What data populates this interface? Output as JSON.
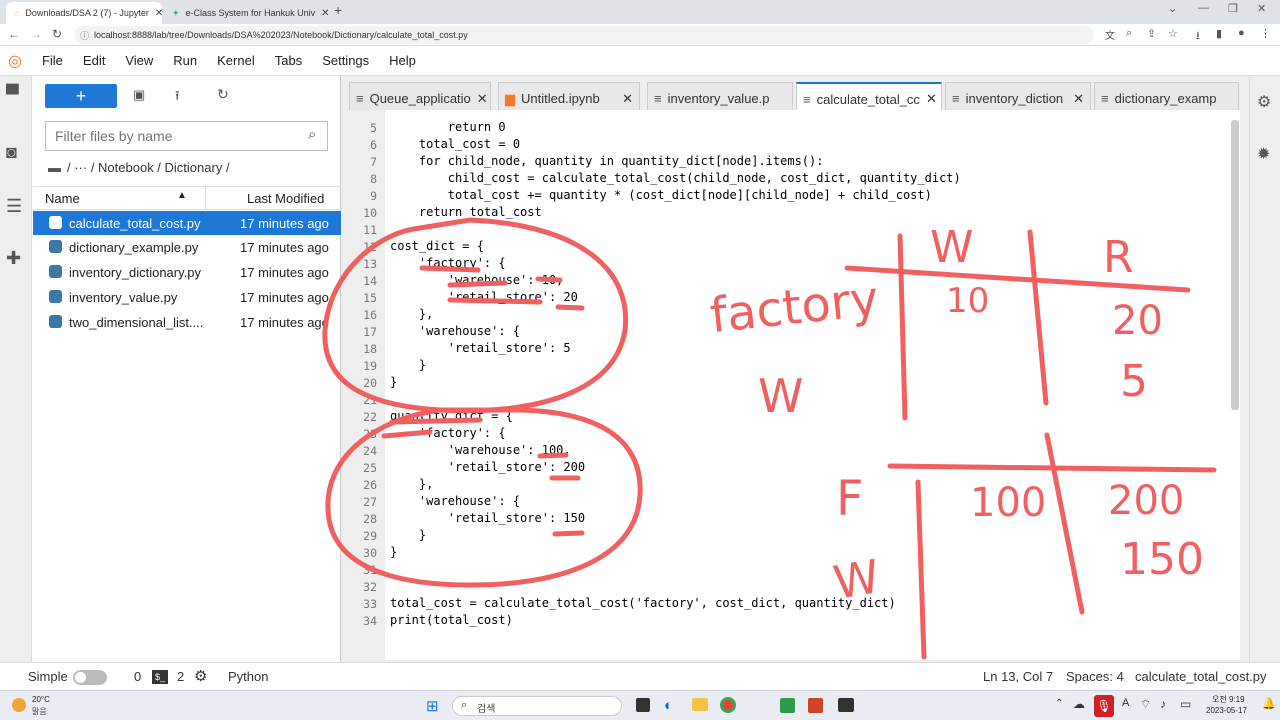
{
  "browser": {
    "tabs": [
      {
        "label": "Downloads/DSA 2 (7) - Jupyter",
        "close": "✕"
      },
      {
        "label": "e-Class System for Hankuk Univ",
        "close": "✕"
      }
    ],
    "new_tab": "+",
    "url": "localhost:8888/lab/tree/Downloads/DSA%202023/Notebook/Dictionary/calculate_total_cost.py"
  },
  "menu": [
    "File",
    "Edit",
    "View",
    "Run",
    "Kernel",
    "Tabs",
    "Settings",
    "Help"
  ],
  "filebrowser": {
    "new_button": "+",
    "filter_placeholder": "Filter files by name",
    "breadcrumb": "/ ··· / Notebook / Dictionary /",
    "col_name": "Name",
    "col_modified": "Last Modified",
    "files": [
      {
        "name": "calculate_total_cost.py",
        "modified": "17 minutes ago"
      },
      {
        "name": "dictionary_example.py",
        "modified": "17 minutes ago"
      },
      {
        "name": "inventory_dictionary.py",
        "modified": "17 minutes ago"
      },
      {
        "name": "inventory_value.py",
        "modified": "17 minutes ago"
      },
      {
        "name": "two_dimensional_list....",
        "modified": "17 minutes ago"
      }
    ]
  },
  "editor_tabs": [
    {
      "label": "Queue_applicatio",
      "close": "✕"
    },
    {
      "label": "Untitled.ipynb",
      "close": "✕"
    },
    {
      "label": "inventory_value.p",
      "close": "✕"
    },
    {
      "label": "calculate_total_cc",
      "close": "✕"
    },
    {
      "label": "inventory_diction",
      "close": "✕"
    },
    {
      "label": "dictionary_examp",
      "close": "✕"
    }
  ],
  "code_lines": [
    {
      "n": "5",
      "t": "        return 0"
    },
    {
      "n": "6",
      "t": "    total_cost = 0"
    },
    {
      "n": "7",
      "t": "    for child_node, quantity in quantity_dict[node].items():"
    },
    {
      "n": "8",
      "t": "        child_cost = calculate_total_cost(child_node, cost_dict, quantity_dict)"
    },
    {
      "n": "9",
      "t": "        total_cost += quantity * (cost_dict[node][child_node] + child_cost)"
    },
    {
      "n": "10",
      "t": "    return total_cost"
    },
    {
      "n": "11",
      "t": ""
    },
    {
      "n": "12",
      "t": "cost_dict = {"
    },
    {
      "n": "13",
      "t": "    'factory': {"
    },
    {
      "n": "14",
      "t": "        'warehouse': 10,"
    },
    {
      "n": "15",
      "t": "        'retail_store': 20"
    },
    {
      "n": "16",
      "t": "    },"
    },
    {
      "n": "17",
      "t": "    'warehouse': {"
    },
    {
      "n": "18",
      "t": "        'retail_store': 5"
    },
    {
      "n": "19",
      "t": "    }"
    },
    {
      "n": "20",
      "t": "}"
    },
    {
      "n": "21",
      "t": ""
    },
    {
      "n": "22",
      "t": "quantity_dict = {"
    },
    {
      "n": "23",
      "t": "    'factory': {"
    },
    {
      "n": "24",
      "t": "        'warehouse': 100,"
    },
    {
      "n": "25",
      "t": "        'retail_store': 200"
    },
    {
      "n": "26",
      "t": "    },"
    },
    {
      "n": "27",
      "t": "    'warehouse': {"
    },
    {
      "n": "28",
      "t": "        'retail_store': 150"
    },
    {
      "n": "29",
      "t": "    }"
    },
    {
      "n": "30",
      "t": "}"
    },
    {
      "n": "31",
      "t": ""
    },
    {
      "n": "32",
      "t": ""
    },
    {
      "n": "33",
      "t": "total_cost = calculate_total_cost('factory', cost_dict, quantity_dict)"
    },
    {
      "n": "34",
      "t": "print(total_cost)"
    }
  ],
  "annotations": {
    "table1": {
      "row1": "factory",
      "row2": "W",
      "col1": "W",
      "col2": "R",
      "v11": "10",
      "v12": "20",
      "v22": "5"
    },
    "table2": {
      "row1": "F",
      "row2": "W",
      "v11": "100",
      "v12": "200",
      "v22": "150"
    }
  },
  "status": {
    "mode": "Simple",
    "count1": "0",
    "count2": "2",
    "kernel": "Python",
    "position": "Ln 13, Col 7",
    "spaces": "Spaces: 4",
    "filename": "calculate_total_cost.py"
  },
  "taskbar": {
    "weather_temp": "20°C",
    "weather_desc": "맑음",
    "search": "검색",
    "time": "오전 9:19",
    "date": "2023-05-17"
  },
  "colors": {
    "accent": "#1e78d7",
    "annotation": "#f06060"
  }
}
